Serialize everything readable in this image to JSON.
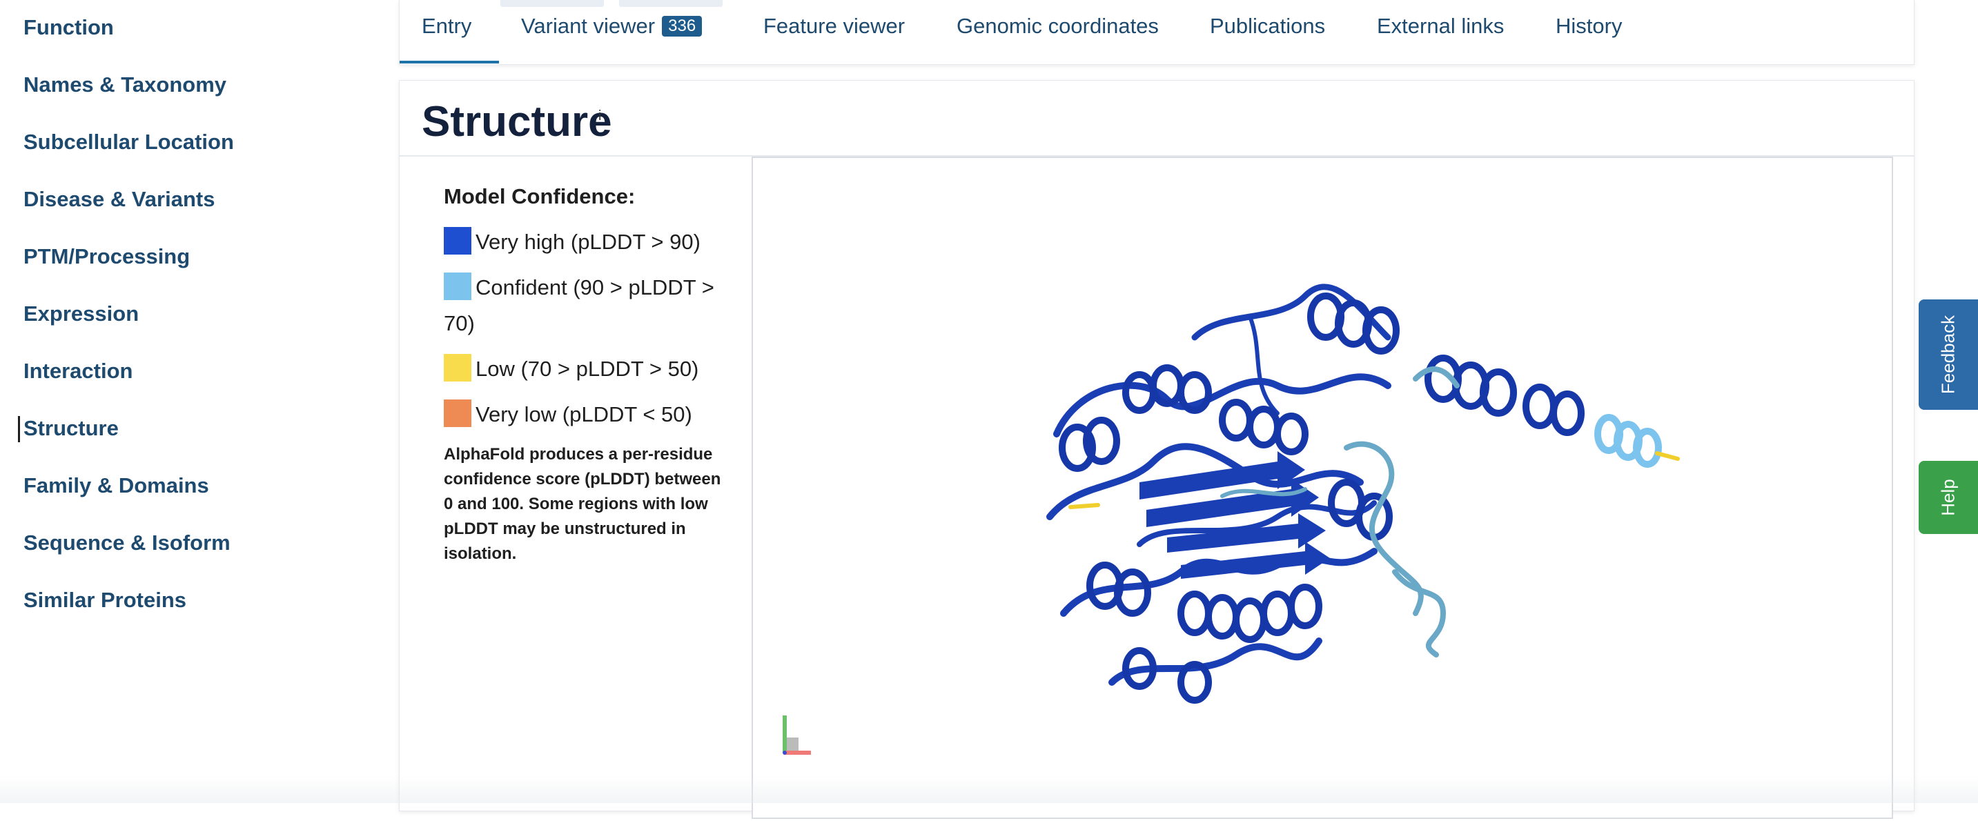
{
  "sidebar": {
    "items": [
      {
        "label": "Function"
      },
      {
        "label": "Names & Taxonomy"
      },
      {
        "label": "Subcellular Location"
      },
      {
        "label": "Disease & Variants"
      },
      {
        "label": "PTM/Processing"
      },
      {
        "label": "Expression"
      },
      {
        "label": "Interaction"
      },
      {
        "label": "Structure",
        "active": true
      },
      {
        "label": "Family & Domains"
      },
      {
        "label": "Sequence & Isoform"
      },
      {
        "label": "Similar Proteins"
      }
    ]
  },
  "tabs": {
    "entry": "Entry",
    "variant_viewer": "Variant viewer",
    "variant_count": "336",
    "feature_viewer": "Feature viewer",
    "genomic_coordinates": "Genomic coordinates",
    "publications": "Publications",
    "external_links": "External links",
    "history": "History",
    "active": "Entry"
  },
  "structure": {
    "title": "Structure",
    "info_marker": "i",
    "legend": {
      "title": "Model Confidence:",
      "items": [
        {
          "label": "Very high (pLDDT > 90)",
          "color": "#1f4fd1"
        },
        {
          "label": "Confident (90 > pLDDT > 70)",
          "color": "#7cc4ee"
        },
        {
          "label": "Low (70 > pLDDT > 50)",
          "color": "#f8dc4c"
        },
        {
          "label": "Very low (pLDDT < 50)",
          "color": "#ee8a54"
        }
      ],
      "note": "AlphaFold produces a per-residue confidence score (pLDDT) between 0 and 100. Some regions with low pLDDT may be unstructured in isolation."
    },
    "viewer_icon": "protein-3d-model"
  },
  "side_tabs": {
    "feedback": {
      "label": "Feedback",
      "color": "#2d6aa8"
    },
    "help": {
      "label": "Help",
      "color": "#3aa04a"
    }
  }
}
